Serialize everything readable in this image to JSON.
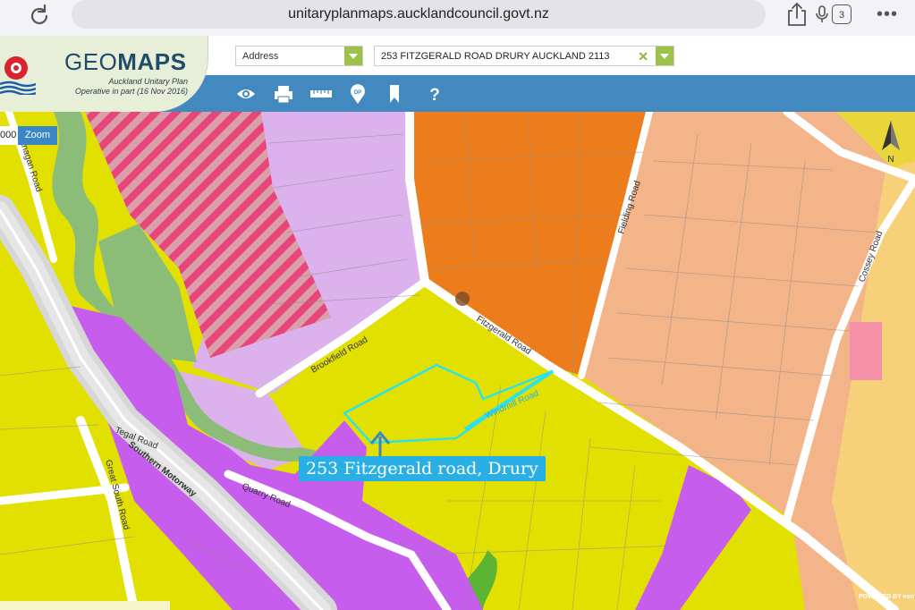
{
  "browser": {
    "url": "unitaryplanmaps.aucklandcouncil.govt.nz",
    "tab_count": "3"
  },
  "header": {
    "brand": "GEOMAPS",
    "brand_light": "GEO",
    "brand_bold": "MAPS",
    "plan_line1": "Auckland Unitary Plan",
    "plan_line2": "Operative in part (16 Nov 2016)"
  },
  "search": {
    "type_selected": "Address",
    "address_value": "253 FITZGERALD ROAD DRURY AUCKLAND 2113"
  },
  "toolbar": {
    "icons": [
      "eye-icon",
      "printer-icon",
      "ruler-icon",
      "dp-pin-icon",
      "bookmark-icon",
      "help-icon"
    ]
  },
  "map": {
    "zoom_label": "Zoom",
    "scale_fragment": "000",
    "callout": "253 Fitzgerald road, Drury",
    "north": "N",
    "attribution": "POWERED BY esri",
    "roads": {
      "fitzgerald": "Fitzgerald Road",
      "brookfield": "Brookfield Road",
      "fielding": "Fielding Road",
      "cossey": "Cossey Road",
      "quarry": "Quarry Road",
      "tegal": "Tegal Road",
      "southern_motorway": "Southern Motorway",
      "great_south": "Great South Road",
      "flanagan": "Flanagan Road",
      "windmill": "Windmill Road"
    },
    "colors": {
      "yellow_zone": "#e2e000",
      "orange_zone": "#ed7d1c",
      "light_orange_zone": "#f4b48a",
      "lilac_zone": "#dcb2ec",
      "purple_zone": "#c75ded",
      "pink_hatch": "#e8467b",
      "green_reserve": "#8cbd78",
      "site_outline": "#29e3ee",
      "toolbar_blue": "#4189bf"
    }
  }
}
